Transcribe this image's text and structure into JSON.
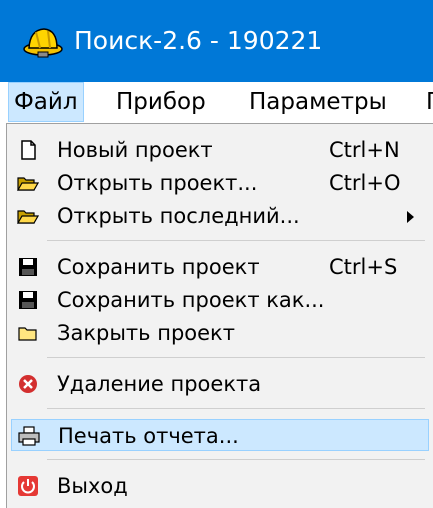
{
  "window": {
    "title": "Поиск-2.6 - 190221"
  },
  "menubar": {
    "file": "Файл",
    "device": "Прибор",
    "params": "Параметры",
    "next": "П"
  },
  "file_menu": {
    "new": {
      "label": "Новый проект",
      "shortcut": "Ctrl+N",
      "icon": "new-document-icon"
    },
    "open": {
      "label": "Открыть проект...",
      "shortcut": "Ctrl+O",
      "icon": "open-folder-icon"
    },
    "open_recent": {
      "label": "Открыть последний...",
      "icon": "open-folder-icon",
      "submenu": true
    },
    "save": {
      "label": "Сохранить проект",
      "shortcut": "Ctrl+S",
      "icon": "floppy-disk-icon"
    },
    "save_as": {
      "label": "Сохранить проект как...",
      "icon": "floppy-disk-icon"
    },
    "close": {
      "label": "Закрыть проект",
      "icon": "closed-folder-icon"
    },
    "delete": {
      "label": "Удаление проекта",
      "icon": "red-x-icon"
    },
    "print": {
      "label": "Печать отчета...",
      "icon": "printer-icon",
      "highlighted": true
    },
    "exit": {
      "label": "Выход",
      "icon": "power-icon"
    }
  },
  "colors": {
    "titlebar": "#0078d7",
    "highlight": "#cce8ff",
    "menu_bg": "#f2f2f2"
  }
}
